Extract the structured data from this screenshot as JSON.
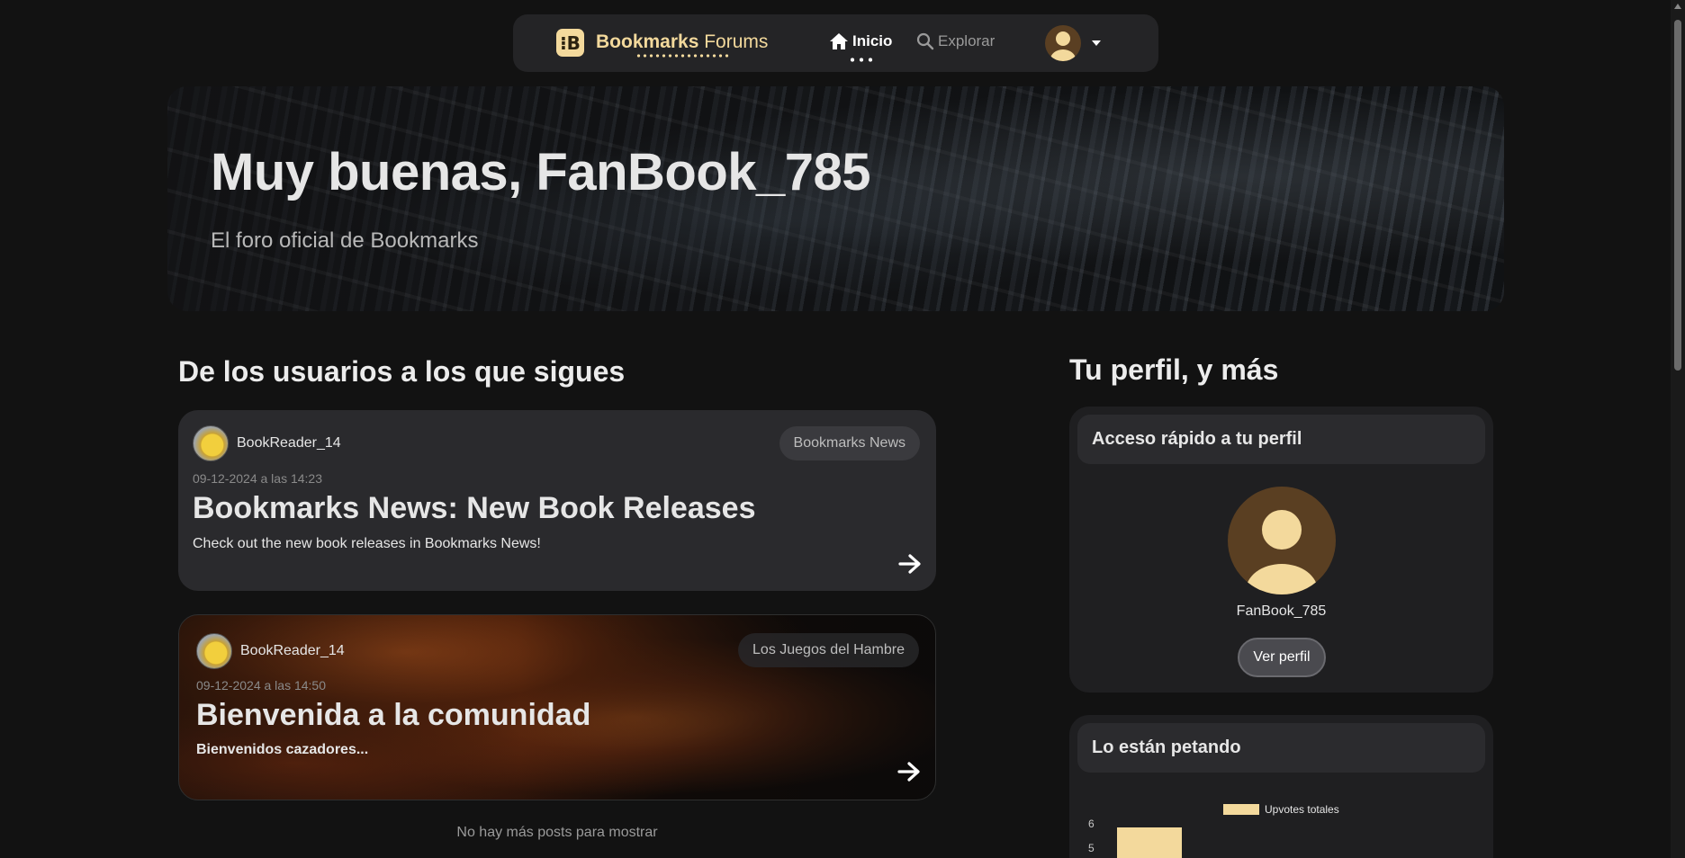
{
  "navbar": {
    "brand_bold": "Bookmarks",
    "brand_light": " Forums",
    "logo_glyph": "⁝B",
    "home_label": "Inicio",
    "explore_label": "Explorar",
    "home_icon": "home-icon",
    "search_icon": "search-icon"
  },
  "hero": {
    "title": "Muy buenas, FanBook_785",
    "subtitle": "El foro oficial de Bookmarks"
  },
  "feed": {
    "section_title": "De los usuarios a los que sigues",
    "posts": [
      {
        "author": "BookReader_14",
        "tag": "Bookmarks News",
        "date": "09-12-2024 a las 14:23",
        "title": "Bookmarks News: New Book Releases",
        "excerpt": "Check out the new book releases in Bookmarks News!"
      },
      {
        "author": "BookReader_14",
        "tag": "Los Juegos del Hambre",
        "date": "09-12-2024 a las 14:50",
        "title": "Bienvenida a la comunidad",
        "excerpt": "Bienvenidos cazadores..."
      }
    ],
    "end_text": "No hay más posts para mostrar"
  },
  "sidebar": {
    "section_title": "Tu perfil, y más",
    "profile_panel": {
      "title": "Acceso rápido a tu perfil",
      "username": "FanBook_785",
      "button_label": "Ver perfil"
    },
    "hot_panel": {
      "title": "Lo están petando"
    }
  },
  "chart_data": {
    "type": "bar",
    "series": [
      {
        "name": "Upvotes totales",
        "values": [
          6
        ]
      }
    ],
    "ytick_labels": [
      "6",
      "5"
    ],
    "colors": [
      "#f3d99c"
    ]
  },
  "colors": {
    "accent": "#f3d99c",
    "background": "#121212",
    "card": "#2a2a2d"
  }
}
